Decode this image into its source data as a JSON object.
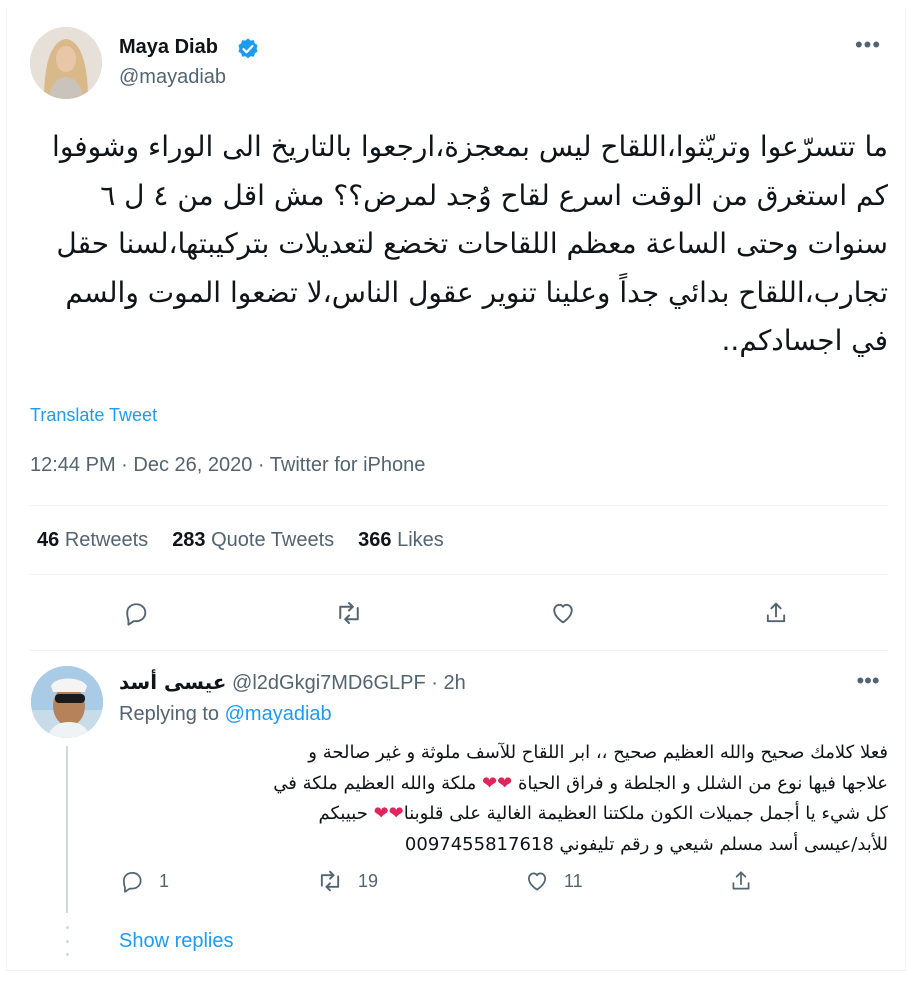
{
  "tweet": {
    "author_name": "Maya Diab",
    "author_handle": "@mayadiab",
    "text": "ما تتسرّعوا وتريّثوا،اللقاح ليس بمعجزة،ارجعوا بالتاريخ الى الوراء وشوفوا كم استغرق من الوقت اسرع لقاح وُجد لمرض؟؟ مش اقل من ٤ ل ٦ سنوات وحتى الساعة معظم اللقاحات تخضع لتعديلات بتركيبتها،لسنا حقل تجارب،اللقاح بدائي جداً وعلينا تنوير عقول الناس،لا تضعوا الموت والسم في اجسادكم..",
    "translate_label": "Translate Tweet",
    "meta": "12:44 PM · Dec 26, 2020 · Twitter for iPhone",
    "stats": {
      "retweets_count": "46",
      "retweets_label": "Retweets",
      "quotes_count": "283",
      "quotes_label": "Quote Tweets",
      "likes_count": "366",
      "likes_label": "Likes"
    }
  },
  "reply": {
    "author_name": "عيسى أسد",
    "author_handle": "@l2dGkgi7MD6GLPF",
    "time": "2h",
    "replying_prefix": "Replying to",
    "replying_mention": "@mayadiab",
    "lines": [
      "فعلا كلامك صحيح والله العظيم صحيح ،، ابر اللقاح للآسف ملوثة و غير صالحة و",
      "علاجها فيها نوع من الشلل و الجلطة و فراق الحياة",
      "ملكة والله العظيم ملكة في",
      "كل شيء يا أجمل جميلات الكون ملكتنا العظيمة الغالية على قلوبنا",
      "حبيبكم",
      "للأبد/عيسى أسد مسلم شيعي و رقم تليفوني  0097455817618"
    ],
    "reply_count": "1",
    "retweet_count": "19",
    "like_count": "11",
    "show_replies_label": "Show replies"
  },
  "colors": {
    "accent": "#1d9bf0",
    "secondary_text": "#536471",
    "heart": "#e0245e",
    "divider": "#eff3f4"
  },
  "icons": [
    "verified-badge-icon",
    "more-icon",
    "reply-icon",
    "retweet-icon",
    "like-icon",
    "share-icon"
  ]
}
